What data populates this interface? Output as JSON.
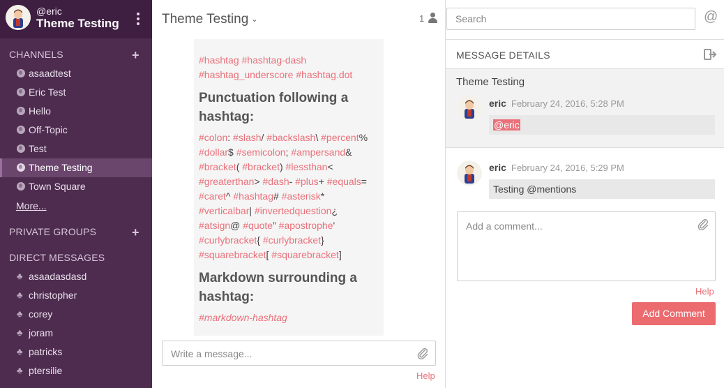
{
  "sidebar": {
    "user_handle": "@eric",
    "team_name": "Theme Testing",
    "channels_header": "CHANNELS",
    "channels": [
      {
        "label": "asaadtest"
      },
      {
        "label": "Eric Test"
      },
      {
        "label": "Hello"
      },
      {
        "label": "Off-Topic"
      },
      {
        "label": "Test"
      },
      {
        "label": "Theme Testing",
        "active": true
      },
      {
        "label": "Town Square"
      }
    ],
    "more_label": "More...",
    "private_groups_header": "PRIVATE GROUPS",
    "direct_messages_header": "DIRECT MESSAGES",
    "direct_messages": [
      {
        "label": "asaadasdasd"
      },
      {
        "label": "christopher"
      },
      {
        "label": "corey"
      },
      {
        "label": "joram"
      },
      {
        "label": "patricks"
      },
      {
        "label": "ptersilie"
      }
    ]
  },
  "channel_header": {
    "title": "Theme Testing",
    "member_count": "1"
  },
  "post": {
    "hashtags_line1": [
      "#hashtag",
      "#hashtag-dash"
    ],
    "hashtags_line2": [
      "#hashtag_underscore",
      "#hashtag.dot"
    ],
    "heading1": "Punctuation following a hashtag:",
    "punctuation_tags": [
      [
        "#colon",
        ": "
      ],
      [
        "#slash",
        "/ "
      ],
      [
        "#backslash",
        "\\ "
      ],
      [
        "#percent",
        "%"
      ],
      [
        "#dollar",
        "$ "
      ],
      [
        "#semicolon",
        "; "
      ],
      [
        "#ampersand",
        "&"
      ],
      [
        "#bracket",
        "( "
      ],
      [
        "#bracket",
        ") "
      ],
      [
        "#lessthan",
        "<"
      ],
      [
        "#greaterthan",
        "> "
      ],
      [
        "#dash",
        "- "
      ],
      [
        "#plus",
        "+ "
      ],
      [
        "#equals",
        "="
      ],
      [
        "#caret",
        "^ "
      ],
      [
        "#hashtag",
        "# "
      ],
      [
        "#asterisk",
        "*"
      ],
      [
        "#verticalbar",
        "| "
      ],
      [
        "#invertedquestion",
        "¿"
      ],
      [
        "#atsign",
        "@ "
      ],
      [
        "#quote",
        "” "
      ],
      [
        "#apostrophe",
        "'"
      ],
      [
        "#curlybracket",
        "{ "
      ],
      [
        "#curlybracket",
        "}"
      ],
      [
        "#squarebracket",
        "[ "
      ],
      [
        "#squarebracket",
        "]"
      ]
    ],
    "heading2": "Markdown surrounding a hashtag:",
    "markdown_tag": "#markdown-hashtag"
  },
  "message_input": {
    "placeholder": "Write a message..."
  },
  "help_label": "Help",
  "search": {
    "placeholder": "Search"
  },
  "mention_button": "@",
  "message_details": {
    "header": "MESSAGE DETAILS",
    "root_title": "Theme Testing",
    "posts": [
      {
        "user": "eric",
        "time": "February 24, 2016, 5:28 PM",
        "message": "@eric"
      },
      {
        "user": "eric",
        "time": "February 24, 2016, 5:29 PM",
        "message": "Testing @mentions"
      }
    ],
    "comment_placeholder": "Add a comment...",
    "help_label": "Help",
    "add_comment_label": "Add Comment"
  },
  "colors": {
    "sidebar_bg": "#4e2c50",
    "sidebar_header_bg": "#3e1f41",
    "active_item_bg": "#6a456c",
    "hashtag": "#e9717a",
    "button": "#ec6b6f"
  },
  "icons": {
    "channel": "globe-icon",
    "direct_message": "person-icon",
    "attach": "paperclip-icon",
    "exit": "exit-icon",
    "menu": "vertical-dots-icon",
    "members": "person-icon"
  }
}
